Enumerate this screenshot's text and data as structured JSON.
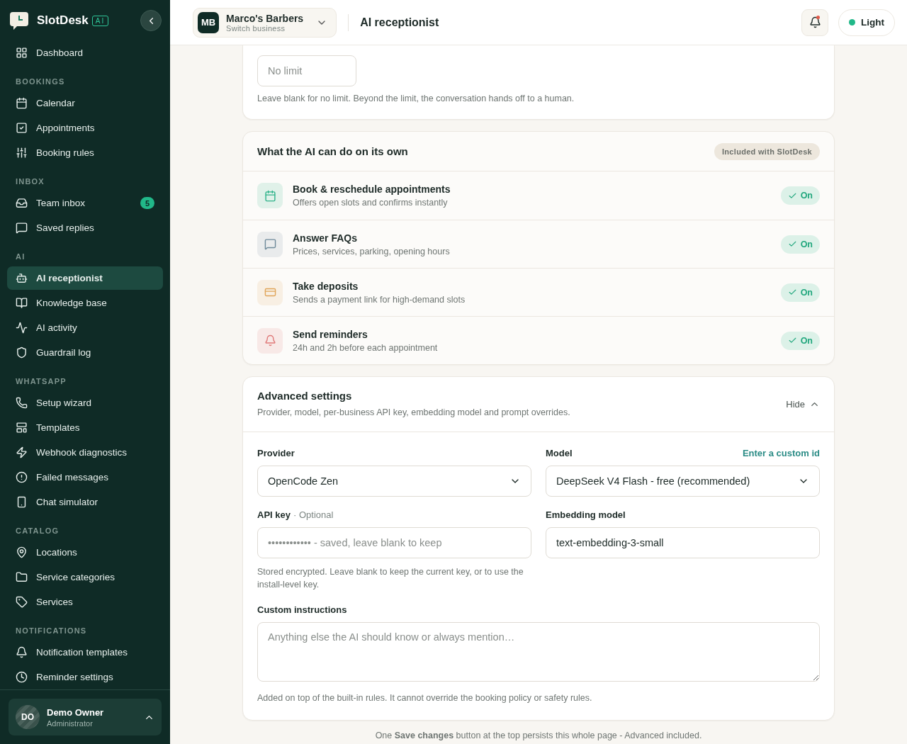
{
  "brand": {
    "name": "SlotDesk",
    "badge": "AI"
  },
  "sidebar": {
    "sections": [
      {
        "items": [
          {
            "label": "Dashboard",
            "selected": false
          }
        ]
      },
      {
        "heading": "BOOKINGS",
        "items": [
          {
            "label": "Calendar",
            "selected": false
          },
          {
            "label": "Appointments",
            "selected": false
          },
          {
            "label": "Booking rules",
            "selected": false
          }
        ]
      },
      {
        "heading": "INBOX",
        "items": [
          {
            "label": "Team inbox",
            "selected": false,
            "badge": "5"
          },
          {
            "label": "Saved replies",
            "selected": false
          }
        ]
      },
      {
        "heading": "AI",
        "items": [
          {
            "label": "AI receptionist",
            "selected": true
          },
          {
            "label": "Knowledge base",
            "selected": false
          },
          {
            "label": "AI activity",
            "selected": false
          },
          {
            "label": "Guardrail log",
            "selected": false
          }
        ]
      },
      {
        "heading": "WHATSAPP",
        "items": [
          {
            "label": "Setup wizard",
            "selected": false
          },
          {
            "label": "Templates",
            "selected": false
          },
          {
            "label": "Webhook diagnostics",
            "selected": false
          },
          {
            "label": "Failed messages",
            "selected": false
          },
          {
            "label": "Chat simulator",
            "selected": false
          }
        ]
      },
      {
        "heading": "CATALOG",
        "items": [
          {
            "label": "Locations",
            "selected": false
          },
          {
            "label": "Service categories",
            "selected": false
          },
          {
            "label": "Services",
            "selected": false
          }
        ]
      },
      {
        "heading": "NOTIFICATIONS",
        "items": [
          {
            "label": "Notification templates",
            "selected": false
          },
          {
            "label": "Reminder settings",
            "selected": false
          }
        ]
      }
    ],
    "user": {
      "initials": "DO",
      "name": "Demo Owner",
      "role": "Administrator"
    }
  },
  "header": {
    "business": {
      "initials": "MB",
      "name": "Marco's Barbers",
      "subtitle": "Switch business"
    },
    "title": "AI receptionist",
    "notifications": {
      "unread": true
    },
    "theme": {
      "label": "Light"
    }
  },
  "limit_card": {
    "placeholder": "No limit",
    "hint": "Leave blank for no limit. Beyond the limit, the conversation hands off to a human."
  },
  "capabilities": {
    "title": "What the AI can do on its own",
    "badge": "Included with SlotDesk",
    "items": [
      {
        "title": "Book & reschedule appointments",
        "subtitle": "Offers open slots and confirms instantly",
        "color": "#2fb38a",
        "on": true,
        "toggle": "On"
      },
      {
        "title": "Answer FAQs",
        "subtitle": "Prices, services, parking, opening hours",
        "color": "#6f8a9a",
        "on": true,
        "toggle": "On"
      },
      {
        "title": "Take deposits",
        "subtitle": "Sends a payment link for high-demand slots",
        "color": "#e0a55a",
        "on": true,
        "toggle": "On"
      },
      {
        "title": "Send reminders",
        "subtitle": "24h and 2h before each appointment",
        "color": "#e07a7a",
        "on": true,
        "toggle": "On"
      }
    ]
  },
  "advanced": {
    "title": "Advanced settings",
    "subtitle": "Provider, model, per-business API key, embedding model and prompt overrides.",
    "toggle": "Hide",
    "expanded": true,
    "provider": {
      "label": "Provider",
      "value": "OpenCode Zen"
    },
    "model": {
      "label": "Model",
      "link": "Enter a custom id",
      "value": "DeepSeek V4 Flash - free (recommended)"
    },
    "api_key": {
      "label": "API key",
      "optional": "· Optional",
      "placeholder": "•••••••••••• - saved, leave blank to keep",
      "hint": "Stored encrypted. Leave blank to keep the current key, or to use the install-level key."
    },
    "embedding": {
      "label": "Embedding model",
      "value": "text-embedding-3-small"
    },
    "instructions": {
      "label": "Custom instructions",
      "placeholder": "Anything else the AI should know or always mention…",
      "hint": "Added on top of the built-in rules. It cannot override the booking policy or safety rules."
    }
  },
  "footer_note": "One **Save changes** button at the top persists this whole page - Advanced included."
}
